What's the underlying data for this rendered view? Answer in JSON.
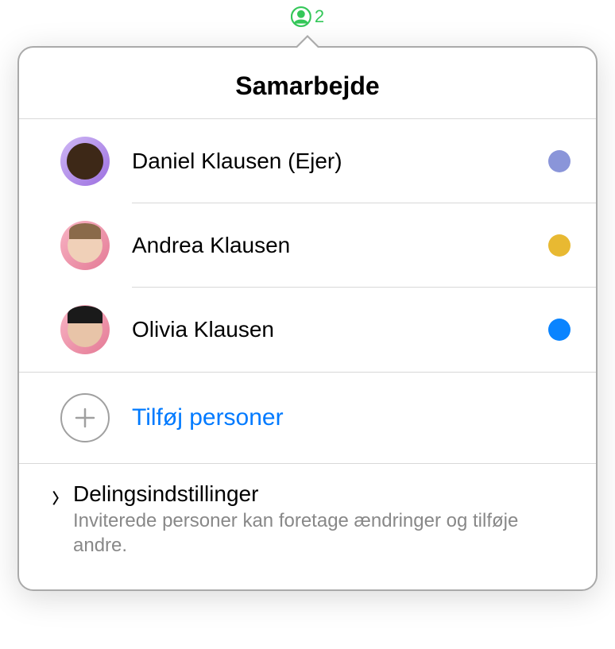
{
  "indicator": {
    "count": "2"
  },
  "popover": {
    "title": "Samarbejde"
  },
  "collaborators": [
    {
      "name": "Daniel Klausen (Ejer)",
      "color": "#8a95d9"
    },
    {
      "name": "Andrea Klausen",
      "color": "#e8b932"
    },
    {
      "name": "Olivia Klausen",
      "color": "#0a84ff"
    }
  ],
  "add_people": {
    "label": "Tilføj personer"
  },
  "settings": {
    "title": "Delingsindstillinger",
    "description": "Inviterede personer kan foretage ændringer og tilføje andre."
  }
}
